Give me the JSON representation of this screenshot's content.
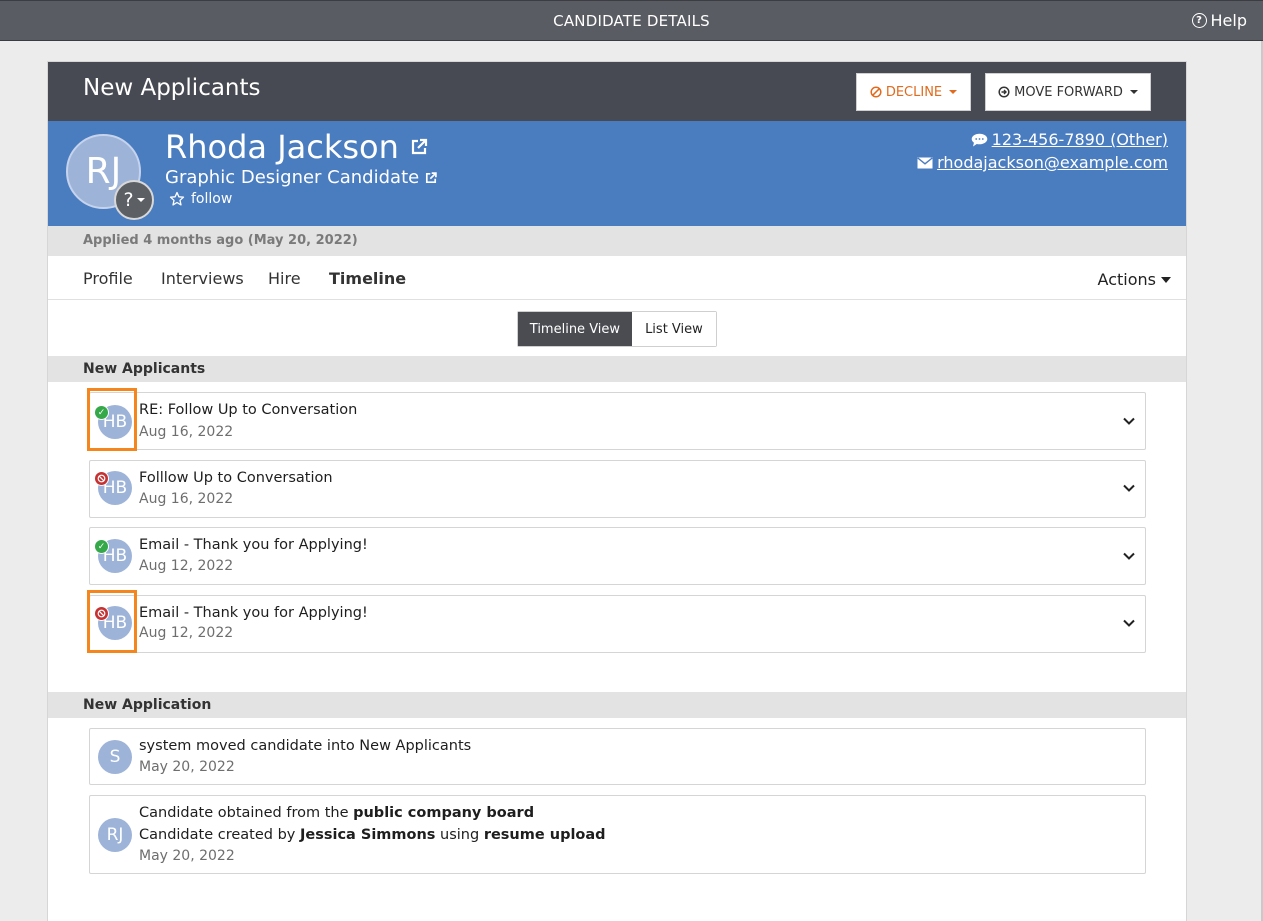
{
  "topbar": {
    "title": "CANDIDATE DETAILS",
    "help_label": "Help"
  },
  "header": {
    "stage_title": "New Applicants",
    "decline_label": "DECLINE",
    "move_forward_label": "MOVE FORWARD"
  },
  "candidate": {
    "initials": "RJ",
    "status_placeholder": "?",
    "name": "Rhoda Jackson",
    "title": "Graphic Designer Candidate",
    "follow_label": "follow",
    "phone": "123-456-7890 (Other)",
    "email": "rhodajackson@example.com"
  },
  "applied_text": "Applied 4 months ago (May 20, 2022)",
  "tabs": [
    {
      "label": "Profile"
    },
    {
      "label": "Interviews"
    },
    {
      "label": "Hire"
    },
    {
      "label": "Timeline"
    }
  ],
  "actions_label": "Actions",
  "view_toggle": {
    "timeline_label": "Timeline View",
    "list_label": "List View"
  },
  "sections": [
    {
      "title": "New Applicants",
      "items": [
        {
          "initials": "HB",
          "status": "sent",
          "title": "RE: Follow Up to Conversation",
          "date": "Aug 16, 2022"
        },
        {
          "initials": "HB",
          "status": "failed",
          "title": "Folllow Up to Conversation",
          "date": "Aug 16, 2022"
        },
        {
          "initials": "HB",
          "status": "sent",
          "title": "Email - Thank you for Applying!",
          "date": "Aug 12, 2022"
        },
        {
          "initials": "HB",
          "status": "failed",
          "title": "Email - Thank you for Applying!",
          "date": "Aug 12, 2022"
        }
      ]
    },
    {
      "title": "New Application",
      "items": [
        {
          "initials": "S",
          "title": "system moved candidate into New Applicants",
          "date": "May 20, 2022"
        },
        {
          "initials": "RJ",
          "line1_prefix": "Candidate obtained from the ",
          "line1_bold": "public company board",
          "line2_prefix": "Candidate created by ",
          "line2_bold1": "Jessica Simmons",
          "line2_mid": " using ",
          "line2_bold2": "resume upload",
          "date": "May 20, 2022"
        }
      ]
    }
  ],
  "colors": {
    "topbar": "#5a5c63",
    "panel_header": "#474a52",
    "hero": "#4a7cc0",
    "decline": "#e06b1f",
    "highlight": "#f5861d",
    "status_ok": "#35a84a",
    "status_failed": "#c63232"
  },
  "icons": {
    "help": "question-circle-icon",
    "decline": "ban-icon",
    "move_forward": "arrow-circle-right-icon",
    "external": "external-link-icon",
    "follow": "star-outline-icon",
    "phone": "comment-icon",
    "email": "envelope-icon",
    "expand": "chevron-down-icon"
  }
}
